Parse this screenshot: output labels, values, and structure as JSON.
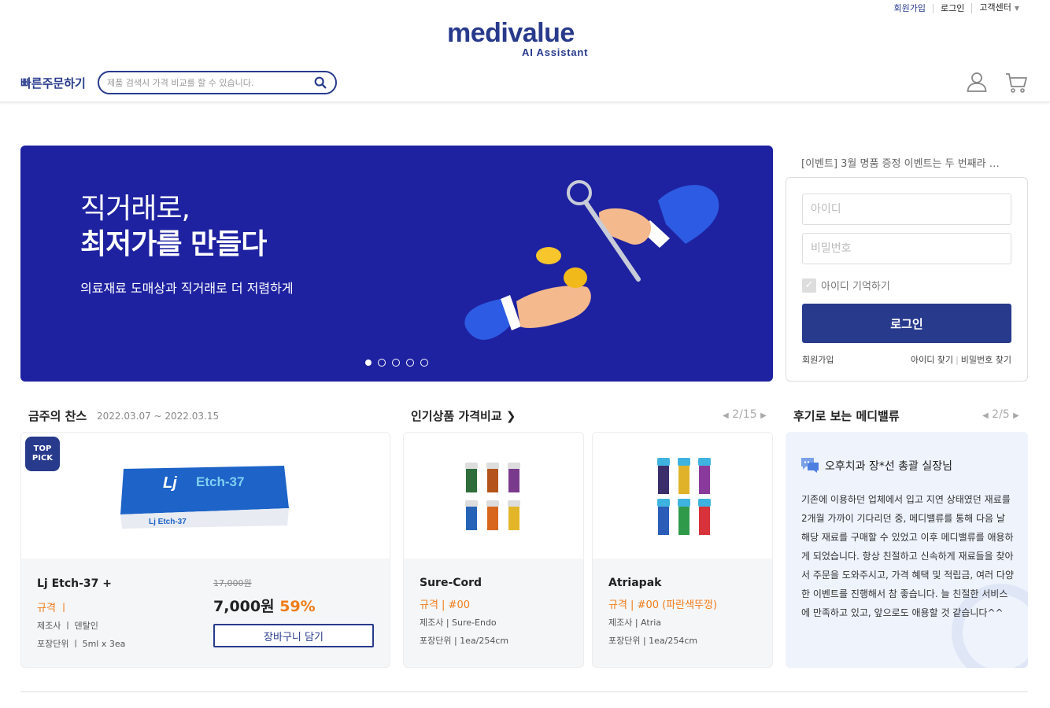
{
  "header": {
    "top_links": [
      "회원가입",
      "로그인",
      "고객센터"
    ],
    "logo": "medivalue",
    "logo_sub": "AI Assistant",
    "quick_order": "빠른주문하기",
    "search_placeholder": "제품 검색시 가격 비교를 할 수 있습니다.",
    "brand_color": "#283a8c"
  },
  "banner": {
    "line1": "직거래로,",
    "line2": "최저가를 만들다",
    "sub": "의료재료 도매상과 직거래로 더 저렴하게",
    "slides": 5,
    "active_slide": 1
  },
  "login": {
    "notice": "[이벤트] 3월 명품 증정 이벤트는 두 번째라 …",
    "id_placeholder": "아이디",
    "pw_placeholder": "비밀번호",
    "remember": "아이디 기억하기",
    "button": "로그인",
    "join": "회원가입",
    "find_id": "아이디 찾기",
    "find_pw": "비밀번호 찾기"
  },
  "weekly": {
    "title": "금주의 찬스",
    "date": "2022.03.07 ~ 2022.03.15",
    "badge": "TOP PICK",
    "name": "Lj Etch-37 +",
    "spec": "규격  ㅣ",
    "maker": "제조사  ㅣ  덴탈인",
    "unit": "포장단위  ㅣ  5ml x 3ea",
    "old_price": "17,000원",
    "price": "7,000원",
    "discount": "59%",
    "cart": "장바구니 담기"
  },
  "popular": {
    "title": "인기상품 가격비교",
    "pager": "2/15",
    "items": [
      {
        "name": "Sure-Cord",
        "spec": "규격 | #00",
        "maker": "제조사 | Sure-Endo",
        "unit": "포장단위 | 1ea/254cm"
      },
      {
        "name": "Atriapak",
        "spec": "규격 | #00 (파란색뚜껑)",
        "maker": "제조사 | Atria",
        "unit": "포장단위 | 1ea/254cm"
      }
    ]
  },
  "review": {
    "title": "후기로 보는 메디밸류",
    "pager": "2/5",
    "author": "오후치과 장*선 총괄 실장님",
    "body": "기존에 이용하던 업체에서 입고 지연 상태였던 재료를 2개월 가까이 기다리던 중, 메디밸류를 통해 다음 날 해당 재료를 구매할 수 있었고 이후 메디밸류를 애용하게 되었습니다. 항상 친절하고 신속하게 재료들을 찾아서 주문을 도와주시고, 가격 혜택 및 적립금, 여러 다양한 이벤트를 진행해서 참 좋습니다. 늘 친절한 서비스에 만족하고 있고, 앞으로도 애용할 것 같습니다^^"
  }
}
